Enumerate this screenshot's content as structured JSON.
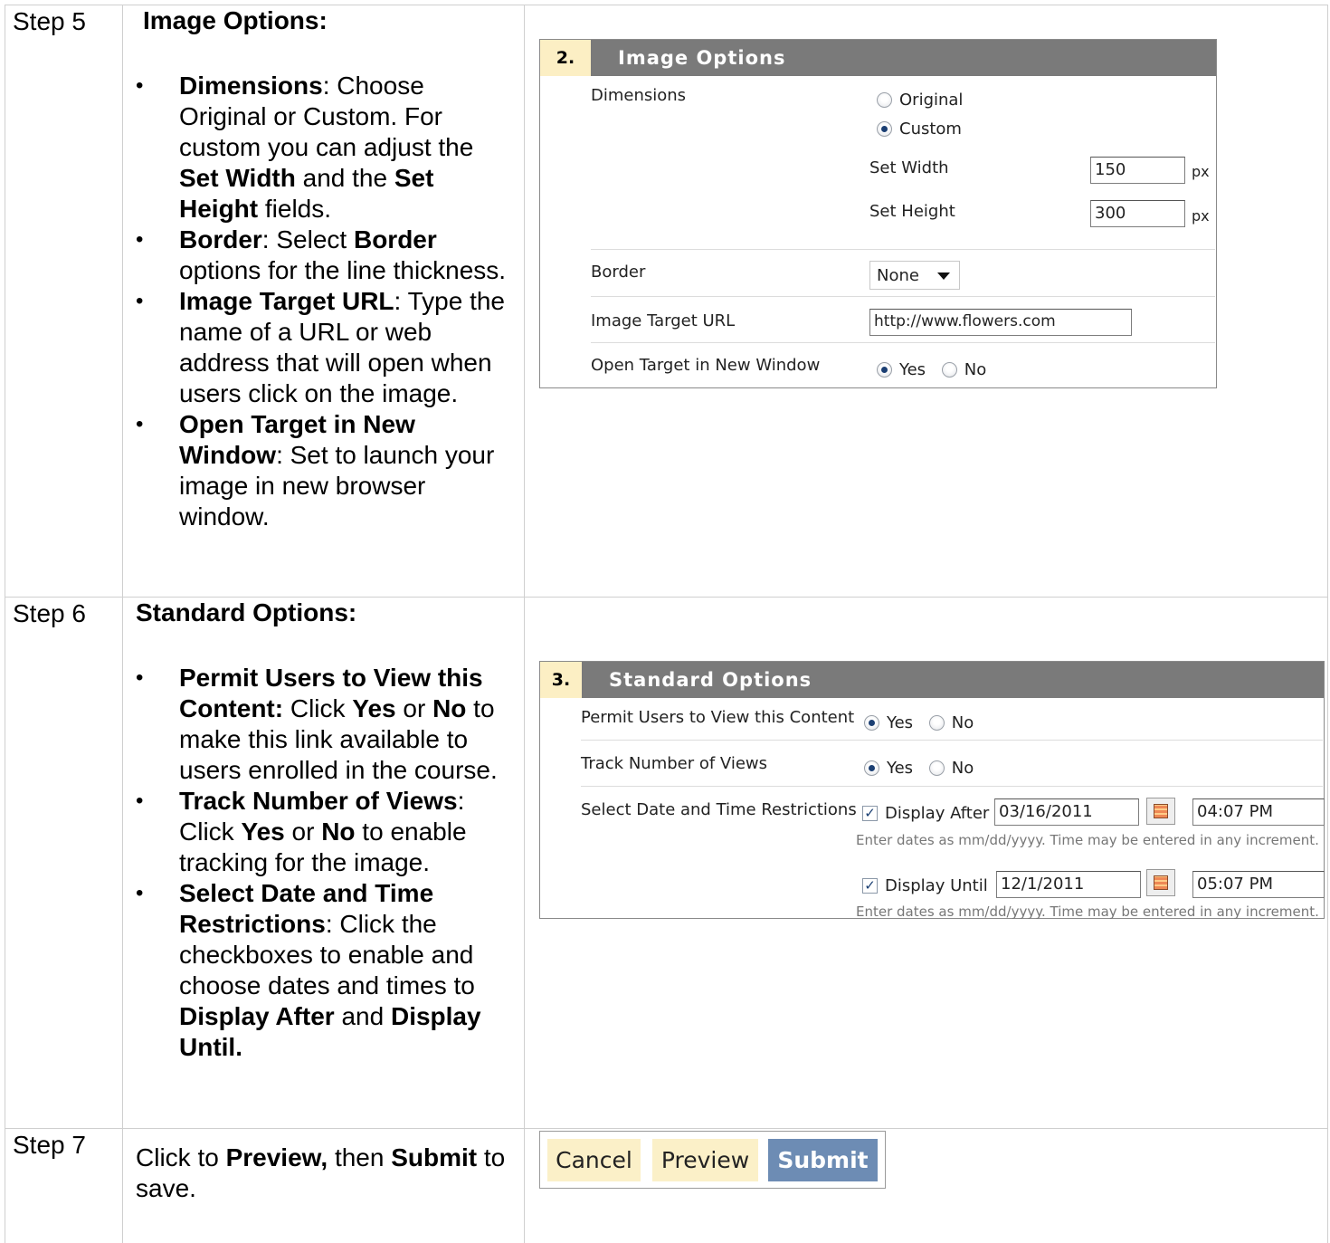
{
  "steps": [
    {
      "label": "Step 5",
      "heading": "Image Options:",
      "bullets": [
        [
          {
            "b": "Dimensions"
          },
          {
            "t": ": Choose Original or Custom. For custom you can adjust the "
          },
          {
            "b": "Set Width"
          },
          {
            "t": " and the "
          },
          {
            "b": "Set Height"
          },
          {
            "t": " fields."
          }
        ],
        [
          {
            "b": "Border"
          },
          {
            "t": ": Select "
          },
          {
            "b": "Border"
          },
          {
            "t": " options for the line thickness."
          }
        ],
        [
          {
            "b": "Image Target URL"
          },
          {
            "t": ": Type the name of a URL or web address that will open when users click on the image."
          }
        ],
        [
          {
            "b": "Open Target in New Window"
          },
          {
            "t": ": Set to launch your image in new browser window."
          }
        ]
      ]
    },
    {
      "label": "Step 6",
      "heading": "Standard Options:",
      "bullets": [
        [
          {
            "b": "Permit Users to View this Content:"
          },
          {
            "t": " Click "
          },
          {
            "b": "Yes"
          },
          {
            "t": " or "
          },
          {
            "b": "No"
          },
          {
            "t": " to make this link available to users enrolled in the course."
          }
        ],
        [
          {
            "b": "Track Number of Views"
          },
          {
            "t": ": Click "
          },
          {
            "b": "Yes"
          },
          {
            "t": " or "
          },
          {
            "b": "No"
          },
          {
            "t": " to enable tracking for the image."
          }
        ],
        [
          {
            "b": "Select Date and Time Restrictions"
          },
          {
            "t": ": Click the checkboxes to enable and choose dates and times to "
          },
          {
            "b": "Display After"
          },
          {
            "t": " and "
          },
          {
            "b": "Display Until."
          }
        ]
      ]
    },
    {
      "label": "Step 7",
      "text": [
        {
          "t": "Click to "
        },
        {
          "b": "Preview,"
        },
        {
          "t": " then "
        },
        {
          "b": "Submit"
        },
        {
          "t": " to save."
        }
      ]
    }
  ],
  "image_options": {
    "number": "2.",
    "title": "Image Options",
    "dimensions_label": "Dimensions",
    "original_label": "Original",
    "custom_label": "Custom",
    "dimensions_selected": "Custom",
    "set_width_label": "Set Width",
    "set_width_value": "150",
    "set_height_label": "Set Height",
    "set_height_value": "300",
    "px_label": "px",
    "border_label": "Border",
    "border_value": "None",
    "target_url_label": "Image Target URL",
    "target_url_value": "http://www.flowers.com",
    "new_window_label": "Open Target in New Window",
    "yes_label": "Yes",
    "no_label": "No",
    "new_window_selected": "Yes"
  },
  "standard_options": {
    "number": "3.",
    "title": "Standard Options",
    "permit_label": "Permit Users to View this Content",
    "permit_selected": "Yes",
    "track_label": "Track Number of Views",
    "track_selected": "Yes",
    "yes_label": "Yes",
    "no_label": "No",
    "restrictions_label": "Select Date and Time Restrictions",
    "display_after_label": "Display After",
    "display_after_checked": true,
    "display_after_date": "03/16/2011",
    "display_after_time": "04:07 PM",
    "display_until_label": "Display Until",
    "display_until_checked": true,
    "display_until_date": "12/1/2011",
    "display_until_time": "05:07 PM",
    "hint": "Enter dates as mm/dd/yyyy. Time may be entered in any increment."
  },
  "buttons": {
    "cancel": "Cancel",
    "preview": "Preview",
    "submit": "Submit"
  },
  "colors": {
    "panel_header": "#7a7a7a",
    "number_badge": "#fcefc4",
    "submit_button": "#6d8cb4",
    "light_button": "#fbf0c8"
  }
}
